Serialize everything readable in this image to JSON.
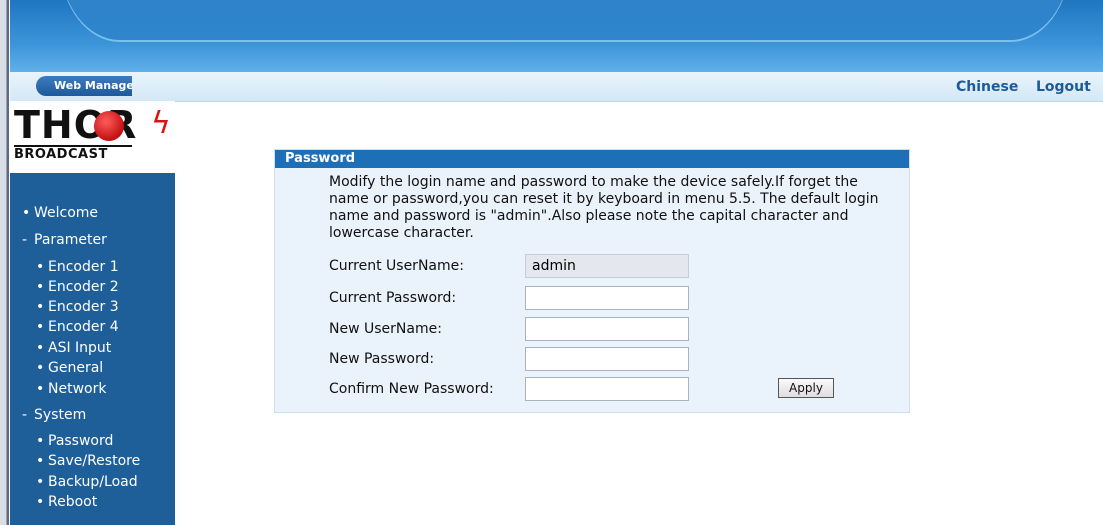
{
  "header": {
    "tab_label": "Web Manage",
    "links": {
      "chinese": "Chinese",
      "logout": "Logout"
    }
  },
  "logo": {
    "main_text": "THOR",
    "sub_text": "BROADCAST"
  },
  "sidebar": {
    "items": [
      {
        "bullet": "•",
        "label": "Welcome"
      },
      {
        "bullet": "-",
        "label": "Parameter"
      },
      {
        "bullet": "•",
        "label": "Encoder 1"
      },
      {
        "bullet": "•",
        "label": "Encoder 2"
      },
      {
        "bullet": "•",
        "label": "Encoder 3"
      },
      {
        "bullet": "•",
        "label": "Encoder 4"
      },
      {
        "bullet": "•",
        "label": "ASI Input"
      },
      {
        "bullet": "•",
        "label": "General"
      },
      {
        "bullet": "•",
        "label": "Network"
      },
      {
        "bullet": "-",
        "label": "System"
      },
      {
        "bullet": "•",
        "label": "Password"
      },
      {
        "bullet": "•",
        "label": "Save/Restore"
      },
      {
        "bullet": "•",
        "label": "Backup/Load"
      },
      {
        "bullet": "•",
        "label": "Reboot"
      }
    ]
  },
  "panel": {
    "title": "Password",
    "description": "Modify the login name and password to make the device safely.If forget the name or password,you can reset it by keyboard in menu 5.5. The default login name and password is \"admin\".Also please note the capital character and lowercase character.",
    "fields": {
      "current_username": {
        "label": "Current UserName:",
        "value": "admin"
      },
      "current_password": {
        "label": "Current Password:",
        "value": ""
      },
      "new_username": {
        "label": "New UserName:",
        "value": ""
      },
      "new_password": {
        "label": "New Password:",
        "value": ""
      },
      "confirm_password": {
        "label": "Confirm New Password:",
        "value": ""
      }
    },
    "apply_label": "Apply"
  }
}
